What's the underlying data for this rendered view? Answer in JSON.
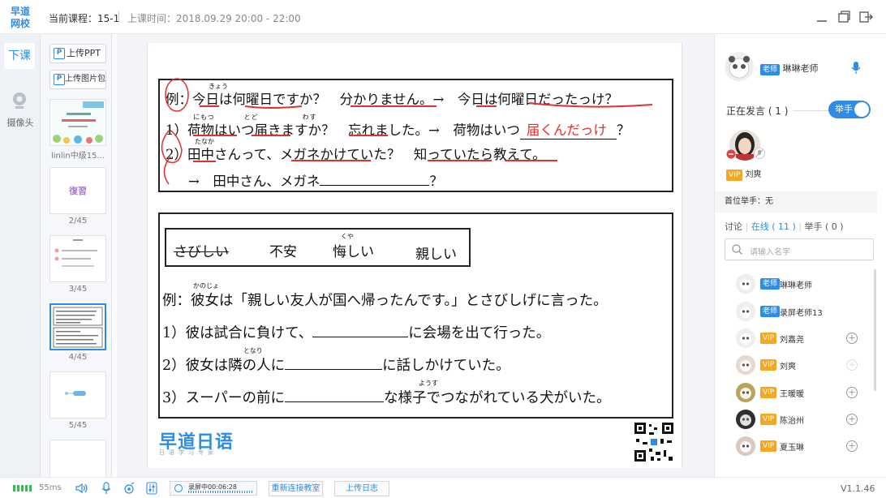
{
  "app": {
    "logo": "早道网校",
    "version": "V1.1.46",
    "brand_color": "#2d8ce6"
  },
  "header": {
    "course": "当前课程：15-1",
    "class_time": "上课时间：2018.09.29 20:00 - 22:00"
  },
  "left_tools": {
    "end_class": "下课",
    "camera": "摄像头"
  },
  "thumbs": {
    "upload_ppt": "上传PPT",
    "upload_images": "上传图片包",
    "items": [
      {
        "label": "linlin中级15..."
      },
      {
        "label": "2/45",
        "title": "復習"
      },
      {
        "label": "3/45"
      },
      {
        "label": "4/45"
      },
      {
        "label": "5/45"
      }
    ]
  },
  "slide": {
    "top_box": {
      "line1": "例：今日は何曜日ですか？　分かりません。→　今日は何曜日だったっけ？",
      "line1_ruby": "きょう",
      "line2_a": "1）荷物はいつ届きますか？　忘れました。→　荷物はいつ",
      "line2_red": "届くんだっけ",
      "line2_end": "？",
      "line2_ruby": "にもつ　　　　とど　　　　　　わす",
      "line3": "2）田中さんって、メガネかけていた？　知っていたら教えて。",
      "line3_ruby": "たなか",
      "line4_a": "→　田中さん、メガネ",
      "line4_end": "？"
    },
    "bottom_box": {
      "words": [
        "さびしい",
        "不安",
        "悔しい",
        "親しい"
      ],
      "word_ruby": "くや",
      "ex": "例：彼女は「親しい友人が国へ帰ったんです。」とさびしげに言った。",
      "ex_ruby": "かのじょ",
      "q1_a": "1）彼は試合に負けて、",
      "q1_b": "に会場を出て行った。",
      "q2_a": "2）彼女は",
      "q2_kanji": "隣",
      "q2_b": "の人に",
      "q2_c": "に話しかけていた。",
      "q2_ruby": "となり",
      "q3_a": "3）スーパーの前に",
      "q3_b": "な様子でつながれている犬がいた。",
      "q3_ruby": "ようす"
    },
    "brand": "早道日语",
    "brand_sub": "日语学习专家"
  },
  "right_panel": {
    "teacher_badge": "老师",
    "teacher_name": "琳琳老师",
    "speaking": "正在发言 ( 1 )",
    "raise_hand": "举手",
    "speaker_badge": "VIP",
    "speaker_name": "刘爽",
    "first_hand": "首位举手：无",
    "tab_discuss": "讨论",
    "tab_online": "在线 ( 11 )",
    "tab_hands": "举手 ( 0 )",
    "tab_sep": "|",
    "search_placeholder": "请输入名字",
    "users": [
      {
        "badge": "老师",
        "name": "琳琳老师",
        "type": "teacher"
      },
      {
        "badge": "老师",
        "name": "录屏老师13",
        "type": "teacher"
      },
      {
        "badge": "VIP",
        "name": "刘嘉尧",
        "type": "vip"
      },
      {
        "badge": "VIP",
        "name": "刘爽",
        "type": "vip"
      },
      {
        "badge": "VIP",
        "name": "王暖暖",
        "type": "vip"
      },
      {
        "badge": "VIP",
        "name": "陈治州",
        "type": "vip"
      },
      {
        "badge": "VIP",
        "name": "夏玉琳",
        "type": "vip"
      }
    ]
  },
  "bottom": {
    "ping": "55ms",
    "recording": "录屏中00:06:28",
    "reconnect": "重新连接教室",
    "upload_log": "上传日志"
  }
}
